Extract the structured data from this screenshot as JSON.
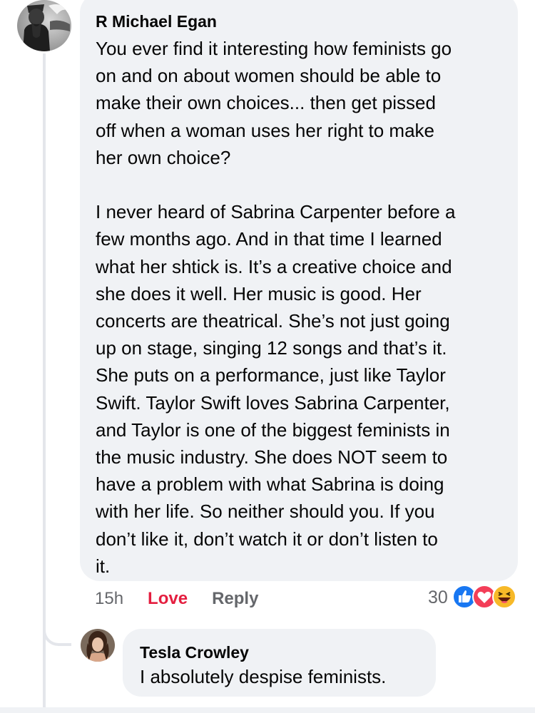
{
  "comment": {
    "author": "R Michael Egan",
    "text": "You ever find it interesting how feminists go\non and on about women should be able to\nmake their own choices... then get pissed\noff when a woman uses her right to make\nher own choice?\n\nI never heard of Sabrina Carpenter before a\nfew months ago. And in that time I learned\nwhat her shtick is. It’s a creative choice and\nshe does it well. Her music is good. Her\nconcerts are theatrical. She’s not just going\nup on stage, singing 12 songs and that’s it.\nShe puts on a performance, just like Taylor\nSwift. Taylor Swift loves Sabrina Carpenter,\nand Taylor is one of the biggest feminists in\nthe music industry. She does NOT seem to\nhave a problem with what Sabrina is doing\nwith her life. So neither should you. If you\ndon’t like it, don’t watch it or don’t listen to\nit.",
    "time": "15h",
    "love_label": "Love",
    "reply_label": "Reply",
    "reaction_count": "30",
    "reactions": [
      "like-icon",
      "love-icon",
      "haha-icon"
    ]
  },
  "reply": {
    "author": "Tesla Crowley",
    "text": "I absolutely despise feminists."
  },
  "colors": {
    "bubble": "#f0f2f5",
    "love": "#e41e3f",
    "meta": "#65676b",
    "like_blue": "#1877f2",
    "heart_red": "#f33e58",
    "haha_yellow": "#f7b928"
  }
}
